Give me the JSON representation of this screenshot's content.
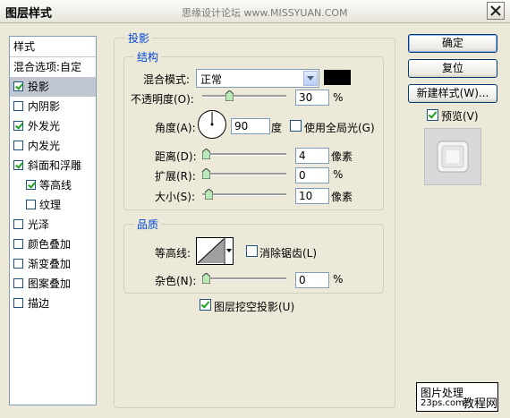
{
  "window": {
    "title": "图层样式",
    "watermark": "思缘设计论坛 www.MISSYUAN.COM"
  },
  "style_list": {
    "header": "样式",
    "blend_options": "混合选项:自定",
    "items": [
      {
        "label": "投影",
        "checked": true,
        "selected": true
      },
      {
        "label": "内阴影",
        "checked": false
      },
      {
        "label": "外发光",
        "checked": true
      },
      {
        "label": "内发光",
        "checked": false
      },
      {
        "label": "斜面和浮雕",
        "checked": true
      },
      {
        "label": "等高线",
        "checked": true,
        "sub": true
      },
      {
        "label": "纹理",
        "checked": false,
        "sub": true
      },
      {
        "label": "光泽",
        "checked": false
      },
      {
        "label": "颜色叠加",
        "checked": false
      },
      {
        "label": "渐变叠加",
        "checked": false
      },
      {
        "label": "图案叠加",
        "checked": false
      },
      {
        "label": "描边",
        "checked": false
      }
    ]
  },
  "drop_shadow": {
    "section_title": "投影",
    "structure": {
      "title": "结构",
      "blend_mode_label": "混合模式:",
      "blend_mode_value": "正常",
      "shadow_color": "#000000",
      "opacity_label": "不透明度(O):",
      "opacity_value": "30",
      "opacity_unit": "%",
      "opacity_level": 0.3,
      "angle_label": "角度(A):",
      "angle_value": "90",
      "angle_unit": "度",
      "global_light_label": "使用全局光(G)",
      "global_light_checked": false,
      "distance_label": "距离(D):",
      "distance_value": "4",
      "distance_unit": "像素",
      "distance_level": 0.0,
      "spread_label": "扩展(R):",
      "spread_value": "0",
      "spread_unit": "%",
      "spread_level": 0.0,
      "size_label": "大小(S):",
      "size_value": "10",
      "size_unit": "像素",
      "size_level": 0.04
    },
    "quality": {
      "title": "品质",
      "contour_label": "等高线:",
      "anti_alias_label": "消除锯齿(L)",
      "anti_alias_checked": false,
      "noise_label": "杂色(N):",
      "noise_value": "0",
      "noise_unit": "%",
      "noise_level": 0.0
    },
    "knockout_label": "图层挖空投影(U)",
    "knockout_checked": true
  },
  "buttons": {
    "ok": "确定",
    "reset": "复位",
    "new_style": "新建样式(W)...",
    "preview_label": "预览(V)",
    "preview_checked": true
  },
  "logo": {
    "line1": "图片处理",
    "line2": "23ps.com",
    "line3": "教程网"
  },
  "colors": {
    "accent": "#0046d5",
    "selected_row": "#c1c7d1",
    "dialog_bg": "#ece9d8"
  }
}
